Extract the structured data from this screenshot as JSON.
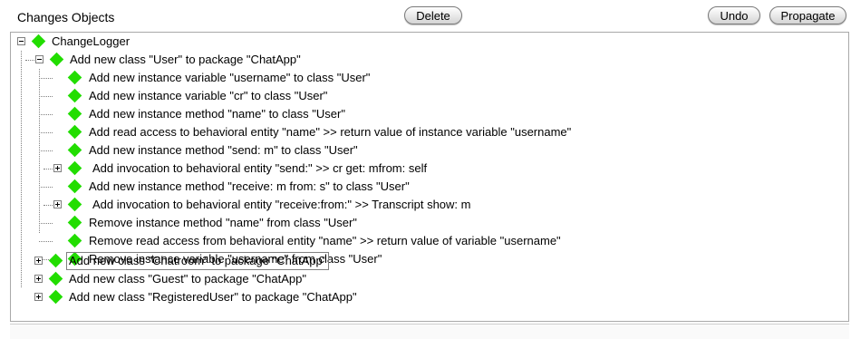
{
  "window": {
    "title": "Changes Objects"
  },
  "toolbar": {
    "delete_label": "Delete",
    "undo_label": "Undo",
    "propagate_label": "Propagate"
  },
  "tree": {
    "root": "ChangeLogger",
    "class_user": "Add new class \"User\" to package \"ChatApp\"",
    "children": [
      "Add new instance variable \"username\" to class \"User\"",
      "Add new instance variable \"cr\" to class \"User\"",
      "Add new instance method \"name\" to class \"User\"",
      "Add read access to behavioral entity \"name\" >> return value of instance variable \"username\"",
      "Add new instance method \"send: m\" to class \"User\"",
      "Add invocation to behavioral entity \"send:\" >> cr get: mfrom: self",
      "Add new instance method \"receive: m from: s\" to class \"User\"",
      "Add invocation to behavioral entity \"receive:from:\" >> Transcript show: m",
      "Remove instance method \"name\" from class \"User\"",
      "Remove read access from behavioral entity \"name\" >> return value of  variable \"username\"",
      "Remove instance variable \"username\" from class \"User\""
    ],
    "class_chatroom": "Add new class \"Chatroom\" to package \"ChatApp\"",
    "class_guest": "Add new class \"Guest\" to package \"ChatApp\"",
    "class_registereduser": "Add new class \"RegisteredUser\" to package \"ChatApp\""
  },
  "colors": {
    "node_diamond": "#22dd00",
    "tree_lines": "#808080",
    "button_border": "#7a7a7a"
  },
  "icons": {
    "node": "green-diamond-icon",
    "collapse": "minus-box-icon",
    "expand": "plus-box-icon"
  }
}
